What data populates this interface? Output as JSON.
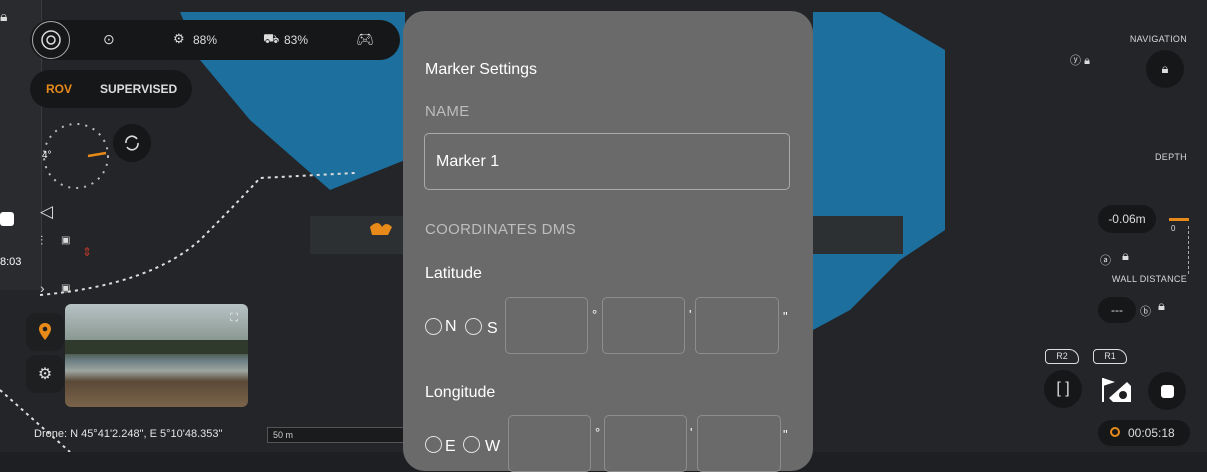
{
  "status_bar": {
    "battery_drone": "88%",
    "battery_controller": "83%"
  },
  "mode": {
    "rov_label": "ROV",
    "supervised_label": "SUPERVISED",
    "active_color": "#e88a1a"
  },
  "compass": {
    "heading": "4°"
  },
  "left_clip": {
    "timer": "8:03"
  },
  "position_text": "Drone: N 45°41'2.248\", E 5°10'48.353\"",
  "scale_label": "50 m",
  "right_panel": {
    "navigation_label": "NAVIGATION",
    "depth_label": "DEPTH",
    "depth_value": "-0.06m",
    "depth_gauge_value": "0",
    "wall_distance_label": "WALL DISTANCE",
    "wall_distance_value": "---",
    "r2_label": "R2",
    "r1_label": "R1",
    "recording_time": "00:05:18"
  },
  "modal": {
    "title": "Marker Settings",
    "name_section": "NAME",
    "name_value": "Marker 1",
    "coordinates_section": "COORDINATES DMS",
    "latitude_label": "Latitude",
    "lat_n": "N",
    "lat_s": "S",
    "longitude_label": "Longitude",
    "lon_e": "E",
    "lon_w": "W",
    "deg_symbol": "°",
    "min_symbol": "'",
    "sec_symbol": "\""
  },
  "colors": {
    "water": "#1d6f9e",
    "accent": "#e88a1a",
    "modal_bg": "#6a6a6a"
  }
}
